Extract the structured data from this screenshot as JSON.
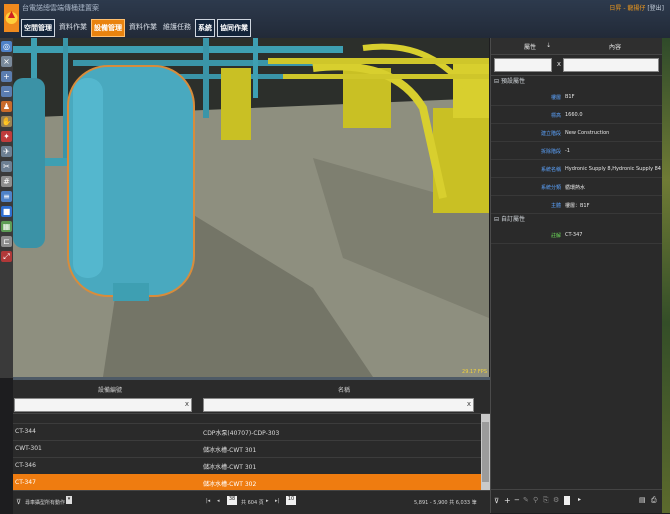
{
  "header": {
    "app_title": "台電諾總雲端傳桶建置案",
    "user_label": "日昇 - 龍揚仔",
    "logout": "[登出]",
    "menu": [
      "空間管理",
      "資料作業",
      "設備管理",
      "資料作業",
      "維護任務",
      "系統",
      "協同作業"
    ]
  },
  "toolbar": {
    "icons": [
      "globe-icon",
      "close-icon",
      "zoom-in-icon",
      "zoom-out-icon",
      "walk-icon",
      "hand-icon",
      "compass-icon",
      "plane-icon",
      "clip-icon",
      "grid-icon",
      "layers-icon",
      "blue-box-icon",
      "map-icon",
      "measure-icon",
      "fullscreen-icon"
    ]
  },
  "viewport": {
    "fps": "29.17 FPS"
  },
  "grid": {
    "col_code": "設備編號",
    "col_name": "名稱",
    "rows": [
      {
        "code": "",
        "name": ""
      },
      {
        "code": "CT-344",
        "name": "CDP水泵(40707)-CDP-303"
      },
      {
        "code": "CWT-301",
        "name": "儲冰水槽-CWT 301"
      },
      {
        "code": "CT-346",
        "name": "儲冰水槽-CWT 301"
      },
      {
        "code": "CT-347",
        "name": "儲冰水槽-CWT 302"
      }
    ],
    "footer": {
      "filter_label": "尋車攝型所有動作",
      "page_value": "38",
      "page_total": "共 604 頁",
      "page_size": "10",
      "range_text": "5,891 - 5,900 共 6,033 筆"
    }
  },
  "properties": {
    "col_attr": "屬性",
    "col_content": "內容",
    "section_basic": "預設屬性",
    "section_custom": "自訂屬性",
    "rows": [
      {
        "key": "樓層",
        "value": "B1F"
      },
      {
        "key": "標高",
        "value": "1660.0"
      },
      {
        "key": "建立階段",
        "value": "New Construction"
      },
      {
        "key": "拆除階段",
        "value": "-1"
      },
      {
        "key": "系統名稱",
        "value": "Hydronic Supply 8,Hydronic Supply 84"
      },
      {
        "key": "系統分類",
        "value": "循環熱水"
      },
      {
        "key": "主體",
        "value": "樓層：B1F"
      }
    ],
    "custom_rows": [
      {
        "key": "註解",
        "value": "CT-347"
      }
    ]
  }
}
